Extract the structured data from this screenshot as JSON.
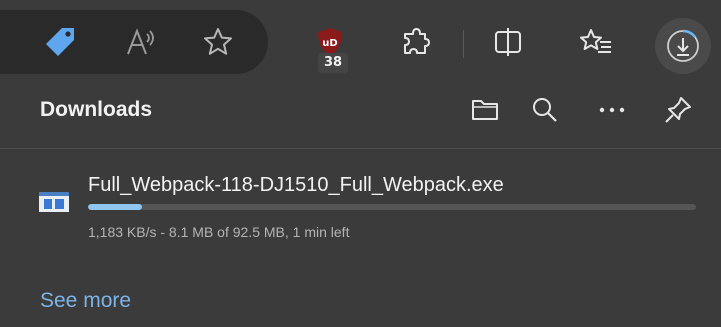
{
  "toolbar": {
    "extension_badge_count": "38",
    "icons": [
      "tag-icon",
      "read-aloud-icon",
      "favorite-star-icon",
      "ublock-icon",
      "extensions-icon",
      "split-screen-icon",
      "favorites-icon",
      "downloads-icon"
    ]
  },
  "downloads": {
    "title": "Downloads",
    "header_actions": [
      "open-folder-icon",
      "search-icon",
      "more-options-icon",
      "pin-icon"
    ],
    "item": {
      "file_name": "Full_Webpack-118-DJ1510_Full_Webpack.exe",
      "status": "1,183 KB/s - 8.1 MB of 92.5 MB, 1 min left",
      "progress_percent": 8.8
    },
    "see_more_label": "See more"
  },
  "colors": {
    "background": "#3b3b3b",
    "link": "#7cb4e8",
    "progress_fill": "#8fc6f0",
    "progress_track": "#555555"
  }
}
